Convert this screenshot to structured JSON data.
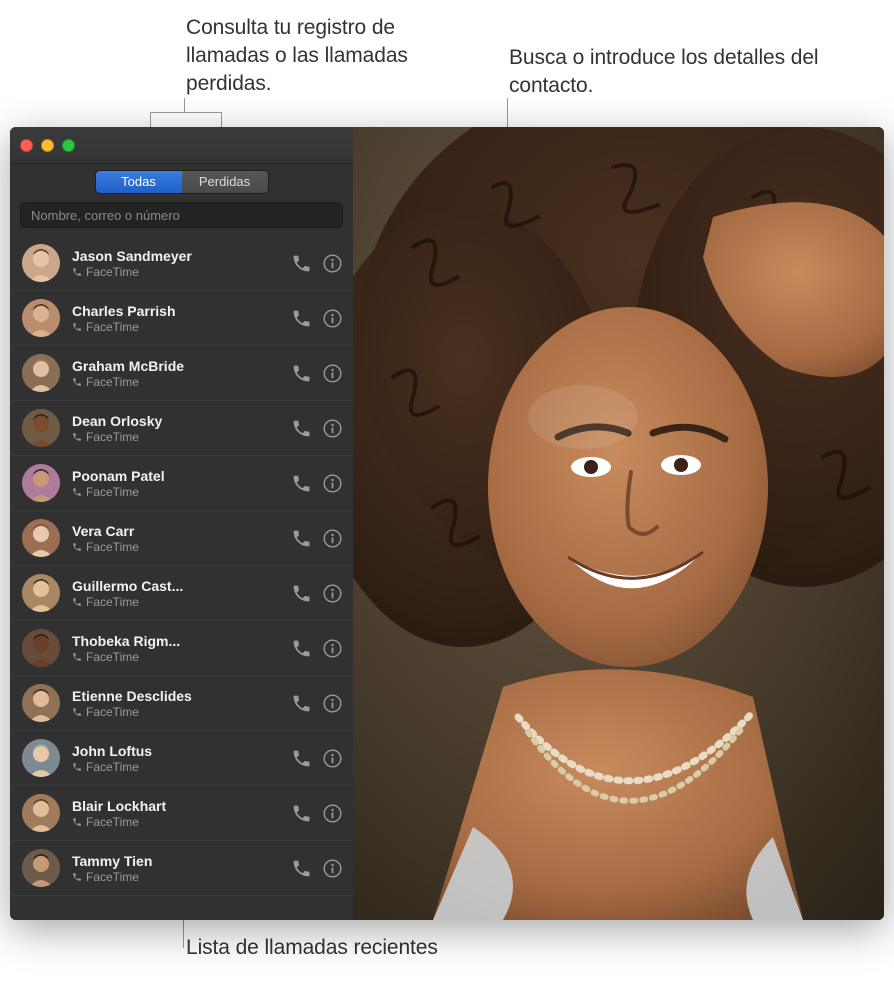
{
  "callouts": {
    "tabs": "Consulta tu registro de llamadas o las llamadas perdidas.",
    "search": "Busca o introduce los detalles del contacto.",
    "list": "Lista de llamadas recientes"
  },
  "traffic": {
    "close_color": "#ff5f57",
    "min_color": "#febc2e",
    "max_color": "#28c840"
  },
  "tabs": {
    "all": "Todas",
    "missed": "Perdidas",
    "active": "all"
  },
  "search": {
    "placeholder": "Nombre, correo o número"
  },
  "contacts": [
    {
      "name": "Jason Sandmeyer",
      "service": "FaceTime",
      "avatar_bg": "#caa78a",
      "avatar_skin": "#e6c4a5",
      "avatar_hair": "#4b3525"
    },
    {
      "name": "Charles Parrish",
      "service": "FaceTime",
      "avatar_bg": "#ba8d6e",
      "avatar_skin": "#d9b290",
      "avatar_hair": "#3b2a1d"
    },
    {
      "name": "Graham McBride",
      "service": "FaceTime",
      "avatar_bg": "#8a6f56",
      "avatar_skin": "#e0c0a0",
      "avatar_hair": "#9b7a56"
    },
    {
      "name": "Dean Orlosky",
      "service": "FaceTime",
      "avatar_bg": "#6f5a44",
      "avatar_skin": "#7b4a2f",
      "avatar_hair": "#2a1a10"
    },
    {
      "name": "Poonam Patel",
      "service": "FaceTime",
      "avatar_bg": "#b07a9b",
      "avatar_skin": "#c69779",
      "avatar_hair": "#2e1e18"
    },
    {
      "name": "Vera Carr",
      "service": "FaceTime",
      "avatar_bg": "#9c6f55",
      "avatar_skin": "#e8c9ad",
      "avatar_hair": "#7a4f2e"
    },
    {
      "name": "Guillermo Cast...",
      "service": "FaceTime",
      "avatar_bg": "#a98763",
      "avatar_skin": "#e3c19c",
      "avatar_hair": "#3c2a1c"
    },
    {
      "name": "Thobeka Rigm...",
      "service": "FaceTime",
      "avatar_bg": "#6a4a3a",
      "avatar_skin": "#6a3f2a",
      "avatar_hair": "#1f1410"
    },
    {
      "name": "Etienne Desclides",
      "service": "FaceTime",
      "avatar_bg": "#8f7155",
      "avatar_skin": "#e0bc99",
      "avatar_hair": "#3a2b1e"
    },
    {
      "name": "John Loftus",
      "service": "FaceTime",
      "avatar_bg": "#7e8a92",
      "avatar_skin": "#e6c8aa",
      "avatar_hair": "#a0a6aa"
    },
    {
      "name": "Blair Lockhart",
      "service": "FaceTime",
      "avatar_bg": "#a07a5c",
      "avatar_skin": "#e2bd98",
      "avatar_hair": "#5a3a24"
    },
    {
      "name": "Tammy Tien",
      "service": "FaceTime",
      "avatar_bg": "#6c5a4a",
      "avatar_skin": "#c79a76",
      "avatar_hair": "#2a1c14"
    }
  ]
}
